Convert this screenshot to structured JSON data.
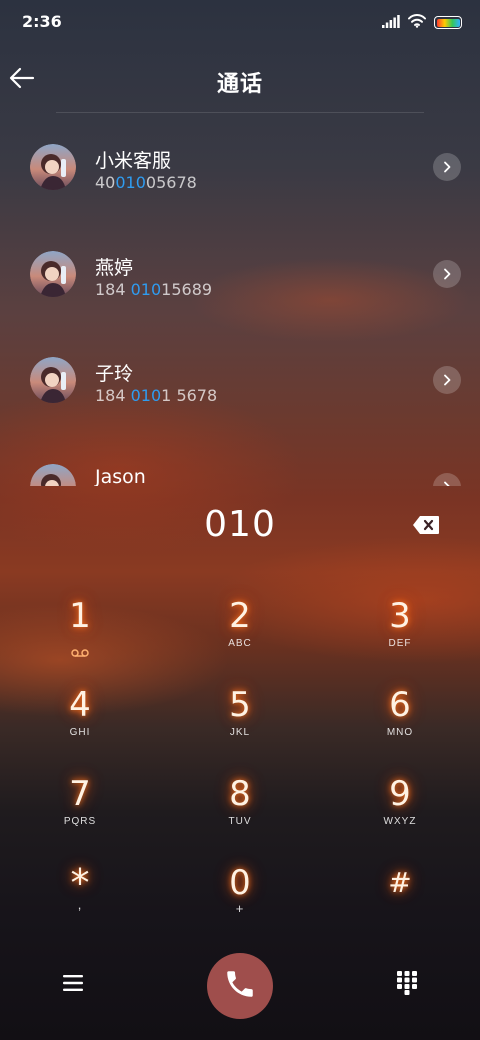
{
  "status_bar": {
    "time": "2:36",
    "icons": [
      "signal-icon",
      "wifi-icon",
      "battery-icon"
    ]
  },
  "header": {
    "title": "通话",
    "back_icon": "arrow-left-icon"
  },
  "search_query": "010",
  "results": [
    {
      "name": "小米客服",
      "number_prefix": "40",
      "number_match": "010",
      "number_suffix": "05678"
    },
    {
      "name": "燕婷",
      "number_prefix": "184 ",
      "number_match": "010",
      "number_suffix": "15689"
    },
    {
      "name": "子玲",
      "number_prefix": "184 ",
      "number_match": "010",
      "number_suffix": "1 5678"
    },
    {
      "name": "Jason",
      "number_prefix": "",
      "number_match": "",
      "number_suffix": ""
    }
  ],
  "keypad": [
    {
      "digit": "1",
      "letters": ""
    },
    {
      "digit": "2",
      "letters": "ABC"
    },
    {
      "digit": "3",
      "letters": "DEF"
    },
    {
      "digit": "4",
      "letters": "GHI"
    },
    {
      "digit": "5",
      "letters": "JKL"
    },
    {
      "digit": "6",
      "letters": "MNO"
    },
    {
      "digit": "7",
      "letters": "PQRS"
    },
    {
      "digit": "8",
      "letters": "TUV"
    },
    {
      "digit": "9",
      "letters": "WXYZ"
    },
    {
      "digit": "*",
      "letters": ","
    },
    {
      "digit": "0",
      "letters": "+"
    },
    {
      "digit": "#",
      "letters": ""
    }
  ],
  "colors": {
    "match_highlight": "#2f9cf0",
    "call_button": "#9f4e4c",
    "digit_glow": "#ff7a1e"
  }
}
